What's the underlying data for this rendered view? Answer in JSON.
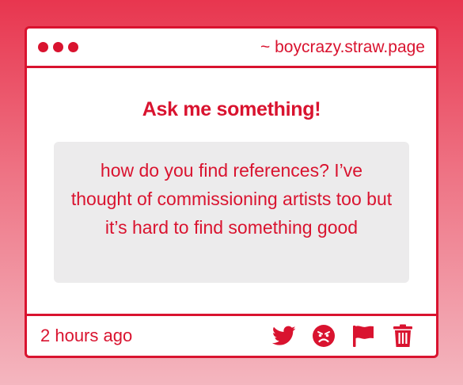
{
  "window": {
    "url": "~ boycrazy.straw.page"
  },
  "main": {
    "heading": "Ask me something!",
    "question": "how do you find references? I’ve thought of commissioning artists too but it’s hard to find something good"
  },
  "footer": {
    "timestamp": "2 hours ago",
    "actions": [
      {
        "icon": "twitter-icon"
      },
      {
        "icon": "angry-face-icon"
      },
      {
        "icon": "flag-icon"
      },
      {
        "icon": "trash-icon"
      }
    ]
  },
  "colors": {
    "accent": "#d9132f",
    "question_bg": "#ecebec",
    "page_gradient_top": "#e8364f",
    "page_gradient_bottom": "#f4b6bf"
  }
}
